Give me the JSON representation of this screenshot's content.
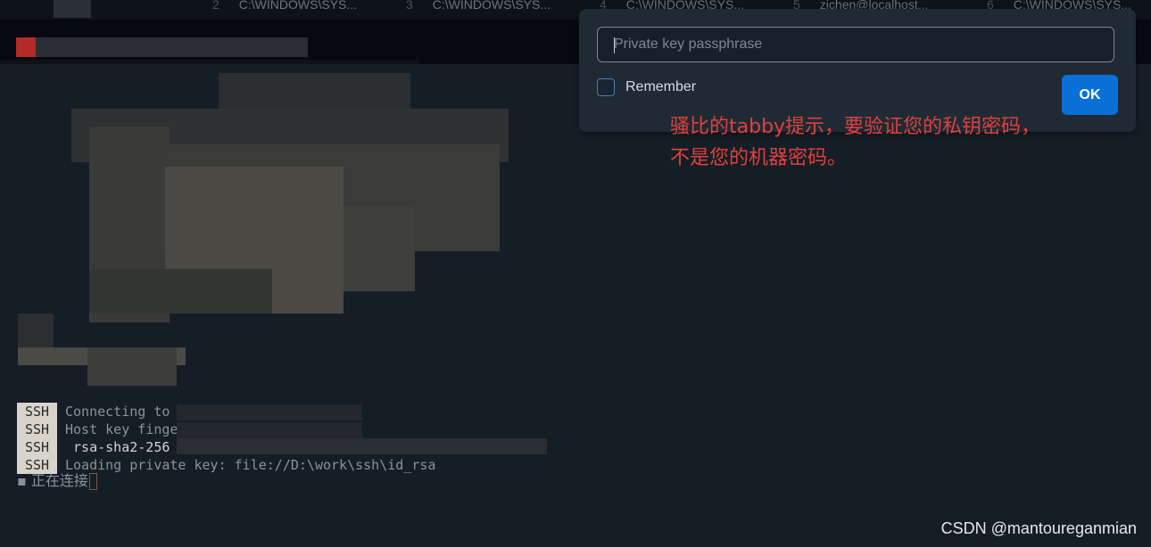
{
  "tabs": [
    {
      "num": "2",
      "label": "C:\\WINDOWS\\SYS..."
    },
    {
      "num": "3",
      "label": "C:\\WINDOWS\\SYS..."
    },
    {
      "num": "4",
      "label": "C:\\WINDOWS\\SYS..."
    },
    {
      "num": "5",
      "label": "zichen@localhost..."
    },
    {
      "num": "6",
      "label": "C:\\WINDOWS\\SYS..."
    }
  ],
  "dialog": {
    "passphrase_placeholder": "Private key passphrase",
    "remember_label": "Remember",
    "ok_label": "OK"
  },
  "annotation": {
    "line1": "骚比的tabby提示，要验证您的私钥密码，",
    "line2": "不是您的机器密码。"
  },
  "terminal": {
    "ssh_badge": "SSH",
    "lines": [
      "Connecting to",
      "Host key fingerprint:",
      " rsa-sha2-256",
      "Loading private key: file://D:\\work\\ssh\\id_rsa"
    ],
    "status_line": "▪ 正在连接"
  },
  "watermark": "CSDN @mantoureganmian",
  "colors": {
    "accent": "#0b6fd8",
    "annotation": "#e0413b",
    "background": "#141c26"
  }
}
